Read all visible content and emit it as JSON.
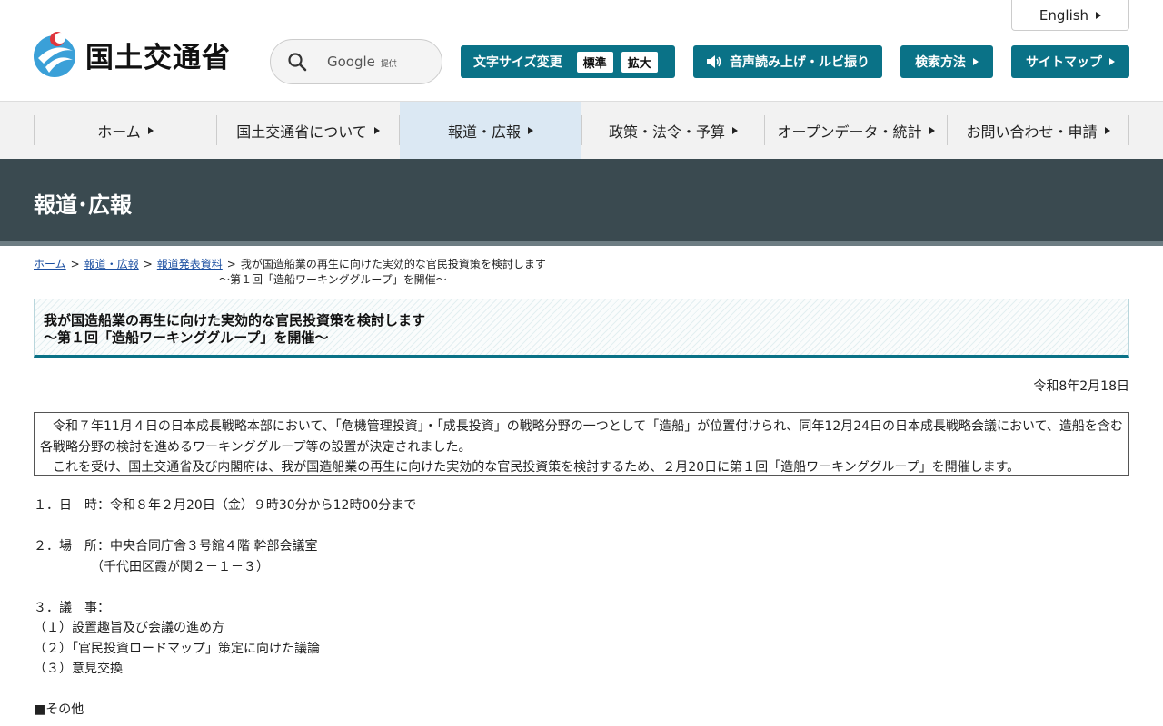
{
  "header": {
    "logo_text": "国土交通省",
    "search": {
      "brand": "Google",
      "provided": "提供"
    },
    "english_label": "English",
    "font_size": {
      "label": "文字サイズ変更",
      "options": [
        "標準",
        "拡大"
      ]
    },
    "voice_label": "音声読み上げ・ルビ振り",
    "search_method_label": "検索方法",
    "sitemap_label": "サイトマップ"
  },
  "nav": {
    "items": [
      {
        "label": "ホーム"
      },
      {
        "label": "国土交通省について"
      },
      {
        "label": "報道・広報",
        "active": true
      },
      {
        "label": "政策・法令・予算"
      },
      {
        "label": "オープンデータ・統計"
      },
      {
        "label": "お問い合わせ・申請"
      }
    ]
  },
  "banner": {
    "title": "報道･広報"
  },
  "breadcrumb": {
    "links": [
      "ホーム",
      "報道・広報",
      "報道発表資料"
    ],
    "current_line1": "我が国造船業の再生に向けた実効的な官民投資策を検討します",
    "current_line2": "～第１回「造船ワーキンググループ」を開催～"
  },
  "article": {
    "title_line1": "我が国造船業の再生に向けた実効的な官民投資策を検討します",
    "title_line2": "～第１回「造船ワーキンググループ」を開催～",
    "date": "令和8年2月18日",
    "lead_p1": "　令和７年11月４日の日本成長戦略本部において、「危機管理投資」・「成長投資」の戦略分野の一つとして「造船」が位置付けられ、同年12月24日の日本成長戦略会議において、造船を含む各戦略分野の検討を進めるワーキンググループ等の設置が決定されました。",
    "lead_p2": "　これを受け、国土交通省及び内閣府は、我が国造船業の再生に向けた実効的な官民投資策を検討するため、２月20日に第１回「造船ワーキンググループ」を開催します。",
    "item1": "１．日　時：令和８年２月20日（金）９時30分から12時00分まで",
    "item2_line1": "２．場　所：中央合同庁舎３号館４階 幹部会議室",
    "item2_line2": "　　　　　（千代田区霞が関２－１－３）",
    "item3_heading": "３．議　事：",
    "agenda": [
      "（１）設置趣旨及び会議の進め方",
      "（２）「官民投資ロードマップ」策定に向けた議論",
      "（３）意見交換"
    ],
    "other_heading": "■その他"
  },
  "colors": {
    "teal": "#0a7287",
    "banner": "#3a4a50",
    "nav_active": "#dbe8f3"
  }
}
